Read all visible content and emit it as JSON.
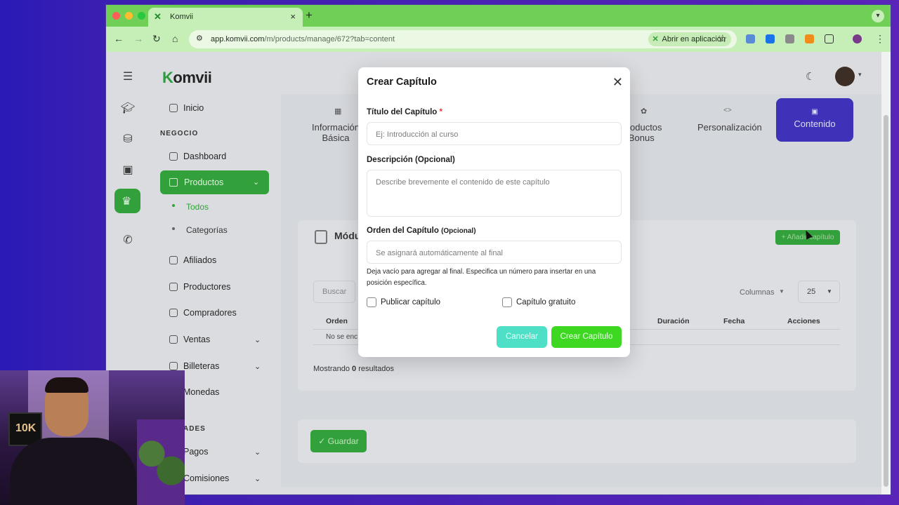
{
  "browser": {
    "tab_title": "Komvii",
    "tab_close": "×",
    "new_tab": "+",
    "url_domain": "app.komvii.com",
    "url_path": "/m/products/manage/672?tab=content",
    "open_in_app": "Abrir en aplicación"
  },
  "app": {
    "logo_prefix": "K",
    "logo_rest": "omvii",
    "sidebar": {
      "inicio": "Inicio",
      "section_negocio": "NEGOCIO",
      "dashboard": "Dashboard",
      "productos": "Productos",
      "todos": "Todos",
      "categorias": "Categorías",
      "afiliados": "Afiliados",
      "productores": "Productores",
      "compradores": "Compradores",
      "ventas": "Ventas",
      "billeteras": "Billeteras",
      "monedas": "Monedas",
      "section_partial": "ADES",
      "pagos": "Pagos",
      "comisiones": "Comisiones"
    },
    "steps": {
      "info_line1": "Información",
      "info_line2": "Básica",
      "bonus_line1": "Productos",
      "bonus_line2": "Bonus",
      "personalizacion": "Personalización",
      "contenido": "Contenido"
    },
    "modules_title": "Módu",
    "add_chapter": "+ Añadir capítulo",
    "search_placeholder": "Buscar",
    "columns_label": "Columnas",
    "per_page": "25",
    "table_headers": {
      "orden": "Orden",
      "duracion": "Duración",
      "fecha": "Fecha",
      "acciones": "Acciones"
    },
    "no_results_partial": "No se enc",
    "showing_prefix": "Mostrando",
    "showing_count": "0",
    "showing_suffix": "resultados",
    "save_button": "✓ Guardar"
  },
  "modal": {
    "title": "Crear Capítulo",
    "title_label": "Título del Capítulo",
    "required_mark": "*",
    "title_placeholder": "Ej: Introducción al curso",
    "desc_label": "Descripción (Opcional)",
    "desc_placeholder": "Describe brevemente el contenido de este capítulo",
    "order_label": "Orden del Capítulo",
    "order_optional": "(Opcional)",
    "order_placeholder": "Se asignará automáticamente al final",
    "order_hint": "Deja vacío para agregar al final. Especifica un número para insertar en una posición específica.",
    "publish_label": "Publicar capítulo",
    "free_label": "Capítulo gratuito",
    "cancel_button": "Cancelar",
    "create_button": "Crear Capítulo"
  },
  "webcam": {
    "poster_text": "10K"
  }
}
